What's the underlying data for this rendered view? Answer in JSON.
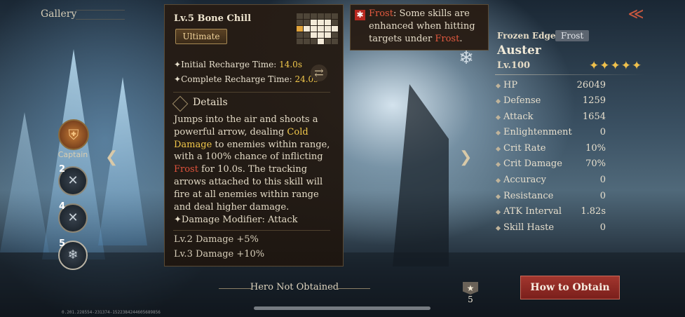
{
  "header": {
    "gallery_label": "Gallery"
  },
  "team": {
    "captain_label": "Captain",
    "slots": [
      {
        "number": "2"
      },
      {
        "number": "4"
      },
      {
        "number": "5"
      }
    ]
  },
  "skill": {
    "title": "Lv.5 Bone Chill",
    "type_badge": "Ultimate",
    "initial_recharge_label": "Initial Recharge Time: ",
    "initial_recharge_value": "14.0s",
    "complete_recharge_label": "Complete Recharge Time: ",
    "complete_recharge_value": "24.0s",
    "details_label": "Details",
    "desc": {
      "p1": "Jumps into the air and shoots a powerful arrow, dealing ",
      "gold1": "Cold Damage",
      "p2": " to enemies within range, with a 100% chance of inflicting ",
      "red1": "Frost",
      "p3": " for 10.0s. The tracking arrows attached to this skill will fire at all enemies within range and deal higher damage."
    },
    "modifier": "Damage Modifier: Attack",
    "levels": [
      "Lv.2 Damage +5%",
      "Lv.3 Damage +10%"
    ]
  },
  "frost_tooltip": {
    "keyword": "Frost",
    "text1": ": Some skills are enhanced when hitting targets under ",
    "keyword2": "Frost",
    "text2": "."
  },
  "hero": {
    "title": "Frozen Edge",
    "element_tag": "Frost",
    "name": "Auster",
    "level": "Lv.100",
    "stars": 5,
    "stats": [
      {
        "name": "HP",
        "value": "26049"
      },
      {
        "name": "Defense",
        "value": "1259"
      },
      {
        "name": "Attack",
        "value": "1654"
      },
      {
        "name": "Enlightenment",
        "value": "0"
      },
      {
        "name": "Crit Rate",
        "value": "10%"
      },
      {
        "name": "Crit Damage",
        "value": "70%"
      },
      {
        "name": "Accuracy",
        "value": "0"
      },
      {
        "name": "Resistance",
        "value": "0"
      },
      {
        "name": "ATK Interval",
        "value": "1.82s"
      },
      {
        "name": "Skill Haste",
        "value": "0"
      }
    ]
  },
  "footer": {
    "status": "Hero Not Obtained",
    "badge_count": "5",
    "obtain_button": "How to Obtain",
    "version": "0.201.228554-231374-1522384244605689856"
  }
}
